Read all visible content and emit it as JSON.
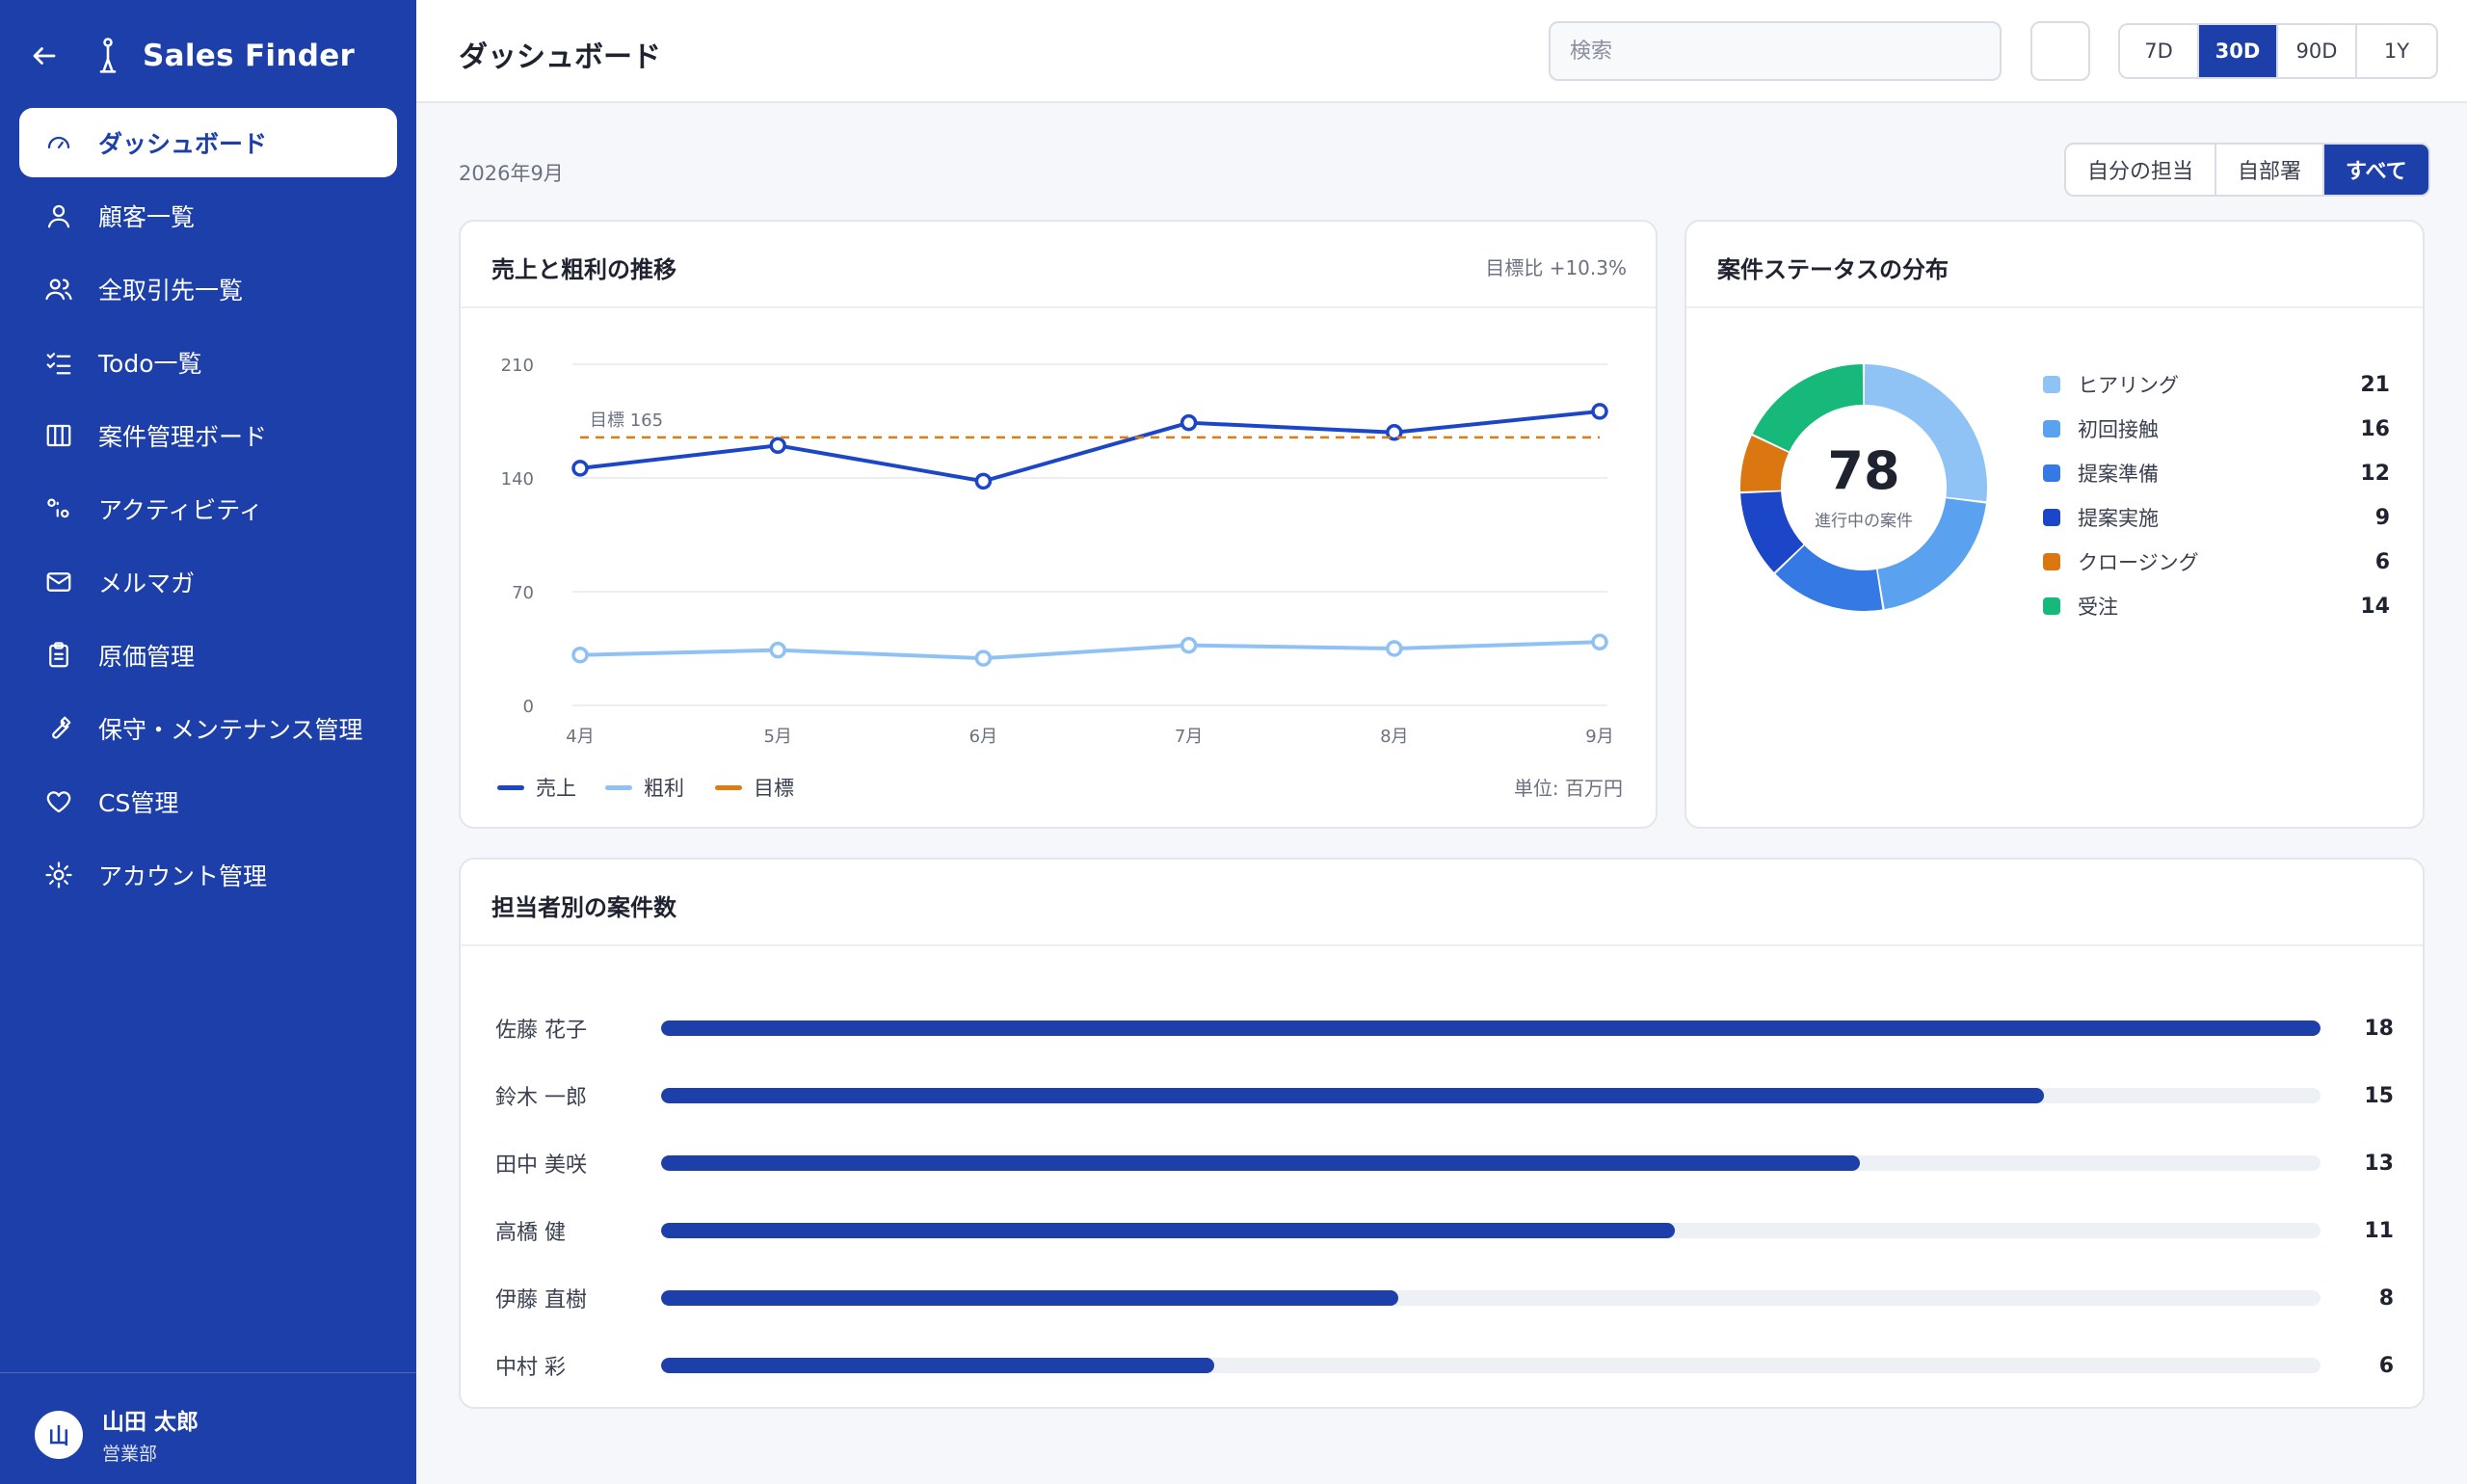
{
  "app": {
    "name": "Sales Finder"
  },
  "sidebar": {
    "items": [
      {
        "label": "ダッシュボード",
        "icon": "gauge-icon",
        "active": true
      },
      {
        "label": "顧客一覧",
        "icon": "user-icon"
      },
      {
        "label": "全取引先一覧",
        "icon": "users-icon"
      },
      {
        "label": "Todo一覧",
        "icon": "checklist-icon"
      },
      {
        "label": "案件管理ボード",
        "icon": "kanban-icon"
      },
      {
        "label": "アクティビティ",
        "icon": "activity-icon"
      },
      {
        "label": "メルマガ",
        "icon": "mail-icon"
      },
      {
        "label": "原価管理",
        "icon": "clipboard-icon"
      },
      {
        "label": "保守・メンテナンス管理",
        "icon": "wrench-icon"
      },
      {
        "label": "CS管理",
        "icon": "heart-icon"
      },
      {
        "label": "アカウント管理",
        "icon": "gear-icon"
      }
    ],
    "user": {
      "initial": "山",
      "name": "山田 太郎",
      "dept": "営業部"
    }
  },
  "header": {
    "title": "ダッシュボード",
    "search_placeholder": "検索",
    "ranges": [
      "7D",
      "30D",
      "90D",
      "1Y"
    ],
    "active_range": "30D"
  },
  "subheader": {
    "date": "2026年9月",
    "scopes": [
      "自分の担当",
      "自部署",
      "すべて"
    ],
    "active_scope": "すべて"
  },
  "line_card": {
    "title": "売上と粗利の推移",
    "note": "目標比 +10.3%",
    "unit": "単位: 百万円",
    "target_label": "目標 165"
  },
  "donut_card": {
    "title": "案件ステータスの分布",
    "total": "78",
    "total_label": "進行中の案件"
  },
  "bar_card": {
    "title": "担当者別の案件数"
  },
  "chart_data": [
    {
      "type": "line",
      "categories": [
        "4月",
        "5月",
        "6月",
        "7月",
        "8月",
        "9月"
      ],
      "series": [
        {
          "name": "売上",
          "values": [
            146,
            160,
            138,
            174,
            168,
            181
          ],
          "color": "#1c46c8"
        },
        {
          "name": "粗利",
          "values": [
            31,
            34,
            29,
            37,
            35,
            39
          ],
          "color": "#8fc1f4"
        },
        {
          "name": "目標",
          "values": [
            165,
            165,
            165,
            165,
            165,
            165
          ],
          "color": "#e07b12",
          "dashed": true
        }
      ],
      "yticks": [
        0,
        70,
        140,
        210
      ],
      "ylim": [
        0,
        210
      ]
    },
    {
      "type": "pie",
      "categories": [
        "ヒアリング",
        "初回接触",
        "提案準備",
        "提案実施",
        "クロージング",
        "受注"
      ],
      "values": [
        21,
        16,
        12,
        9,
        6,
        14
      ],
      "colors": [
        "#90c3f5",
        "#5aa2ef",
        "#3579e4",
        "#1c46c8",
        "#db7710",
        "#16b97a"
      ]
    },
    {
      "type": "bar",
      "categories": [
        "佐藤 花子",
        "鈴木 一郎",
        "田中 美咲",
        "高橋 健",
        "伊藤 直樹",
        "中村 彩"
      ],
      "values": [
        18,
        15,
        13,
        11,
        8,
        6
      ],
      "xlim": [
        0,
        18
      ]
    }
  ]
}
